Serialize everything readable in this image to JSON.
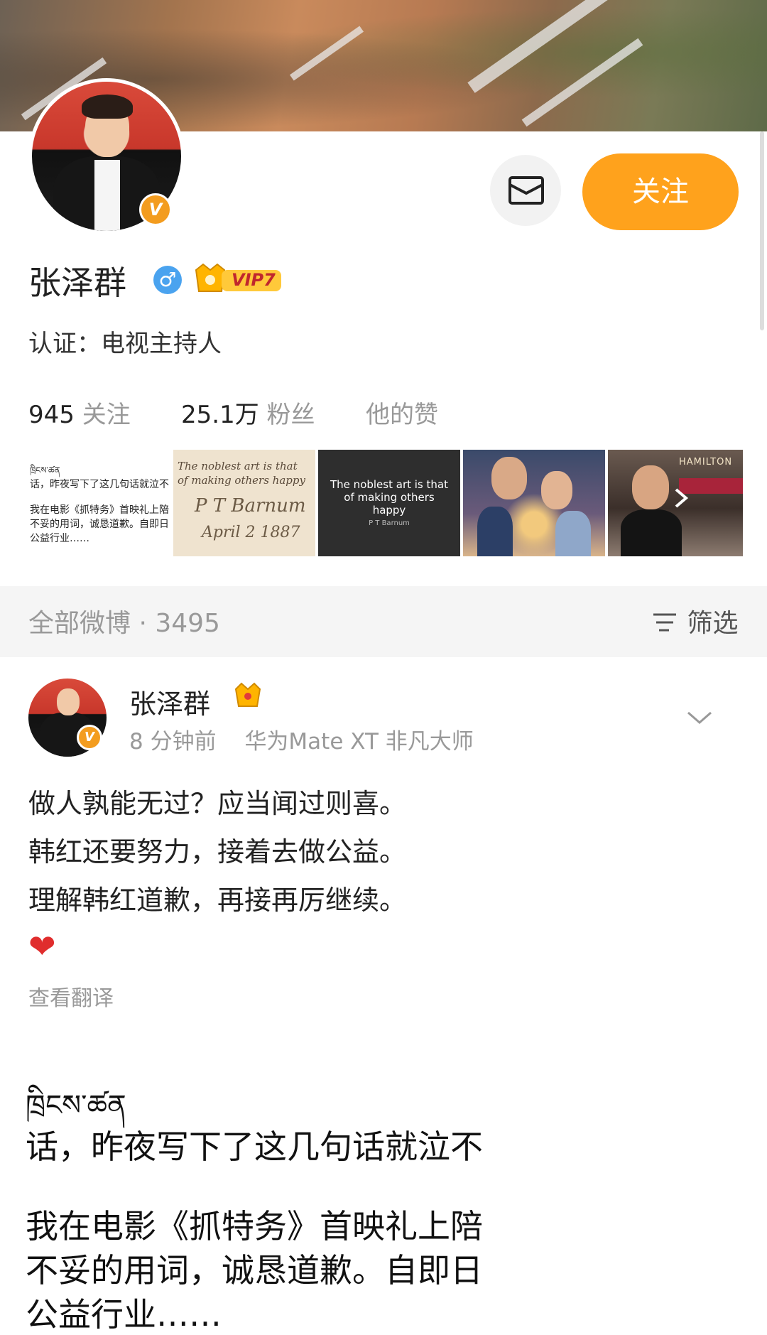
{
  "profile": {
    "name": "张泽群",
    "vip_label": "VIP7",
    "verified_label": "认证：电视主持人",
    "follow_label": "关注",
    "stats": {
      "following_count": "945",
      "following_label": "关注",
      "fans_count": "25.1万",
      "fans_label": "粉丝",
      "likes_label": "他的赞"
    },
    "strip": {
      "t1_line1": "ཁྲིངས་ཚན",
      "t1_line2": "话，昨夜写下了这几句话就泣不",
      "t1_line3": "我在电影《抓特务》首映礼上陪",
      "t1_line4": "不妥的用词，诚恳道歉。自即日",
      "t1_line5": "公益行业……",
      "t2_line1": "The noblest art is that",
      "t2_line2": "of making others happy",
      "t2_sig": "P T Barnum",
      "t2_date": "April 2 1887",
      "t3_line1": "The noblest art is that",
      "t3_line2": "of making others",
      "t3_line3": "happy",
      "t3_line4": "P T Barnum",
      "t5_sign": "HAMILTON"
    }
  },
  "feed_header": {
    "label": "全部微博 · 3495",
    "filter_label": "筛选"
  },
  "post": {
    "author": "张泽群",
    "time": "8 分钟前",
    "device": "华为Mate XT 非凡大师",
    "lines": [
      "做人孰能无过？应当闻过则喜。",
      "韩红还要努力，接着去做公益。",
      "理解韩红道歉，再接再厉继续。"
    ],
    "heart": "❤",
    "translate_label": "查看翻译",
    "embed_lines": [
      "ཁྲིངས་ཚན",
      "话，昨夜写下了这几句话就泣不",
      "",
      "我在电影《抓特务》首映礼上陪",
      "不妥的用词，诚恳道歉。自即日",
      "公益行业……"
    ]
  },
  "colors": {
    "accent": "#ffa21c",
    "verified": "#f39c1f",
    "male": "#4aa3ef",
    "heart": "#e02d2d"
  },
  "icons": {
    "message": "message-icon",
    "gender": "male-icon",
    "filter": "filter-icon",
    "chevron": "chevron-down-icon",
    "strip_next": "chevron-right-icon"
  }
}
